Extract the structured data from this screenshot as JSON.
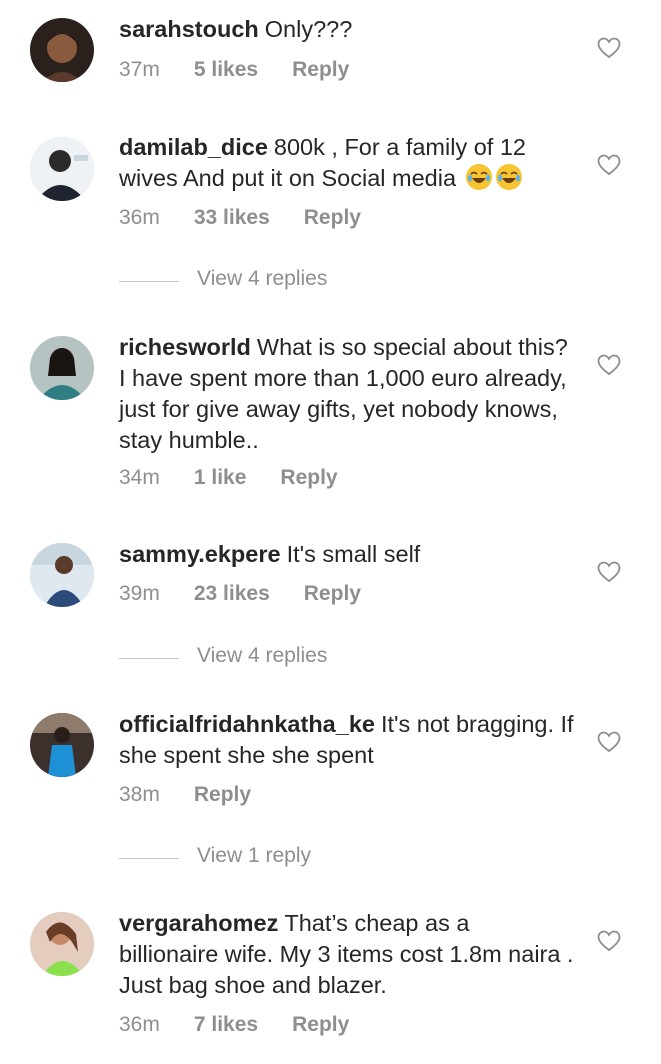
{
  "comments": [
    {
      "username": "sarahstouch",
      "text": "Only???",
      "time": "37m",
      "likes": "5 likes",
      "reply": "Reply",
      "avatar_color": "#3a2a24"
    },
    {
      "username": "damilab_dice",
      "text": "800k , For a family of 12 wives And put it on Social media",
      "emoji": "face-with-tears-of-joy x2",
      "time": "36m",
      "likes": "33 likes",
      "reply": "Reply",
      "view_replies": "View 4 replies",
      "avatar_color": "#e9eef2"
    },
    {
      "username": "richesworld",
      "text": "What is so special about this? I have spent more than 1,000 euro already, just for give away gifts, yet nobody knows, stay humble..",
      "time": "34m",
      "likes": "1 like",
      "reply": "Reply",
      "avatar_color": "#b9c7c6"
    },
    {
      "username": "sammy.ekpere",
      "text": "It's small self",
      "time": "39m",
      "likes": "23 likes",
      "reply": "Reply",
      "view_replies": "View 4 replies",
      "avatar_color": "#d9e3ea"
    },
    {
      "username": "officialfridahnkatha_ke",
      "text": "It's not bragging. If she spent she she spent",
      "time": "38m",
      "reply": "Reply",
      "view_replies": "View 1 reply",
      "avatar_color": "#5a4a44"
    },
    {
      "username": "vergarahomez",
      "text": "That’s cheap as a billionaire wife. My 3 items cost 1.8m naira . Just bag shoe and blazer.",
      "time": "36m",
      "likes": "7 likes",
      "reply": "Reply",
      "avatar_color": "#d8b8a4"
    }
  ],
  "colors": {
    "text": "#262626",
    "meta": "#8e8e8e",
    "heart_outline": "#8e8e8e"
  }
}
